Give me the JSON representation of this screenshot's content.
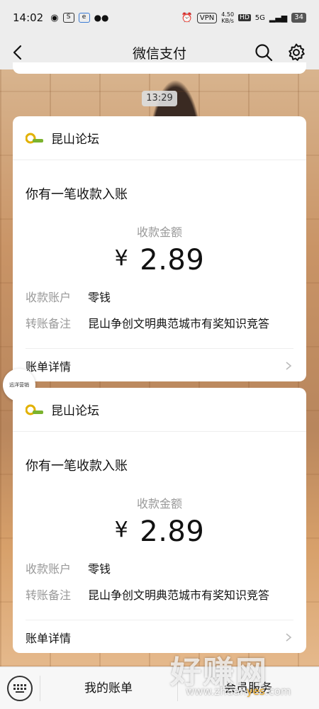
{
  "status_bar": {
    "time": "14:02",
    "net_speed": "4.50\nKB/s",
    "vpn": "VPN",
    "hd": "HD",
    "signal": "5G",
    "battery": "34",
    "icons": [
      "weibo-icon",
      "search-app-icon",
      "message-app-icon",
      "wechat-icon",
      "alarm-icon",
      "signal-icon",
      "battery-icon"
    ]
  },
  "nav": {
    "title": "微信支付",
    "icons": [
      "back-icon",
      "search-icon",
      "gear-icon"
    ]
  },
  "timestamp": "13:29",
  "messages": [
    {
      "source": "昆山论坛",
      "notice": "你有一笔收款入账",
      "amount_label": "收款金额",
      "currency": "¥",
      "amount": "2.89",
      "account_label": "收款账户",
      "account_value": "零钱",
      "memo_label": "转账备注",
      "memo_value": "昆山争创文明典范城市有奖知识竞答",
      "detail_label": "账单详情"
    },
    {
      "source": "昆山论坛",
      "notice": "你有一笔收款入账",
      "amount_label": "收款金额",
      "currency": "¥",
      "amount": "2.89",
      "account_label": "收款账户",
      "account_value": "零钱",
      "memo_label": "转账备注",
      "memo_value": "昆山争创文明典范城市有奖知识竞答",
      "detail_label": "账单详情"
    }
  ],
  "float_badge": "远洋营销",
  "bottom_bar": {
    "bills_label": "我的账单",
    "service_label": "会员服务"
  },
  "watermark": {
    "main": "好赚网",
    "sub_prefix": "www.zhuan",
    "sub_highlight": "yes",
    "sub_suffix": ".com"
  },
  "colors": {
    "bar_bg": "#ededed",
    "card_bg": "#ffffff",
    "muted_text": "#999999",
    "logo_green": "#7bb32e",
    "logo_yellow": "#e2b100"
  }
}
